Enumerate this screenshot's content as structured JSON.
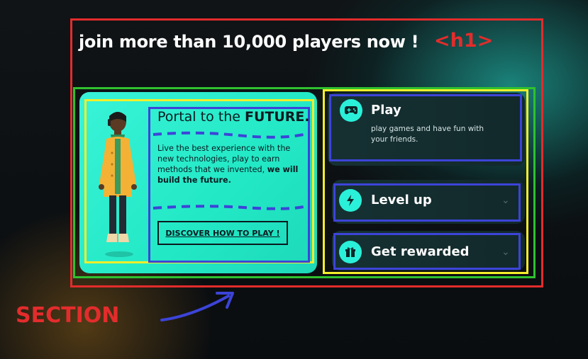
{
  "heading": "join more than 10,000 players now !",
  "annotations": {
    "h1_tag": "<h1>",
    "section_label": "SECTION"
  },
  "promo": {
    "title_prefix": "Portal to the ",
    "title_bold": "FUTURE.",
    "text": "Live the best experience with the new technologies, play to earn methods that we invented, ",
    "text_bold": "we will build the future.",
    "cta_label": "DISCOVER HOW TO PLAY !"
  },
  "features": [
    {
      "title": "Play",
      "description": "play games and have fun with your friends.",
      "icon": "gamepad-icon",
      "expanded": true
    },
    {
      "title": "Level up",
      "icon": "lightning-icon",
      "expanded": false
    },
    {
      "title": "Get rewarded",
      "icon": "gift-icon",
      "expanded": false
    }
  ],
  "colors": {
    "accent": "#2af0d9",
    "annotation_red": "#e32c2c",
    "annotation_green": "#2fc12f",
    "annotation_yellow": "#f3ee2a",
    "annotation_blue": "#3c44d8"
  }
}
